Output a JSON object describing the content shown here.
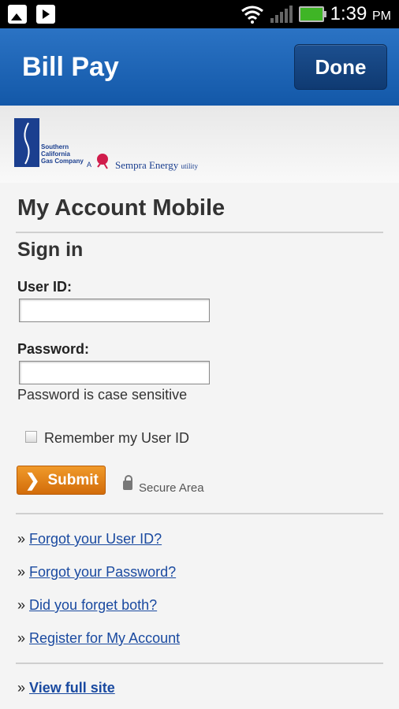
{
  "status_bar": {
    "time": "1:39",
    "ampm": "PM",
    "icons": [
      "gallery-icon",
      "play-store-icon",
      "wifi-icon",
      "signal-icon",
      "battery-icon"
    ]
  },
  "header": {
    "title": "Bill Pay",
    "done_label": "Done"
  },
  "logo": {
    "company_line1": "Southern",
    "company_line2": "California",
    "company_line3": "Gas Company",
    "prefix": "A",
    "parent": "Sempra Energy",
    "suffix": "utility"
  },
  "page": {
    "title": "My Account Mobile",
    "subtitle": "Sign in"
  },
  "form": {
    "user_id_label": "User ID:",
    "user_id_value": "",
    "password_label": "Password:",
    "password_value": "",
    "password_note": "Password is case sensitive",
    "remember_label": "Remember my User ID",
    "submit_label": "Submit",
    "secure_label": "Secure Area"
  },
  "links": {
    "prefix": "»",
    "items": [
      "Forgot your User ID?",
      "Forgot your Password?",
      "Did you forget both?",
      "Register for My Account"
    ],
    "full_site": "View full site"
  },
  "colors": {
    "header": "#1a63b8",
    "submit": "#e5821a",
    "link": "#1a4aa0"
  }
}
